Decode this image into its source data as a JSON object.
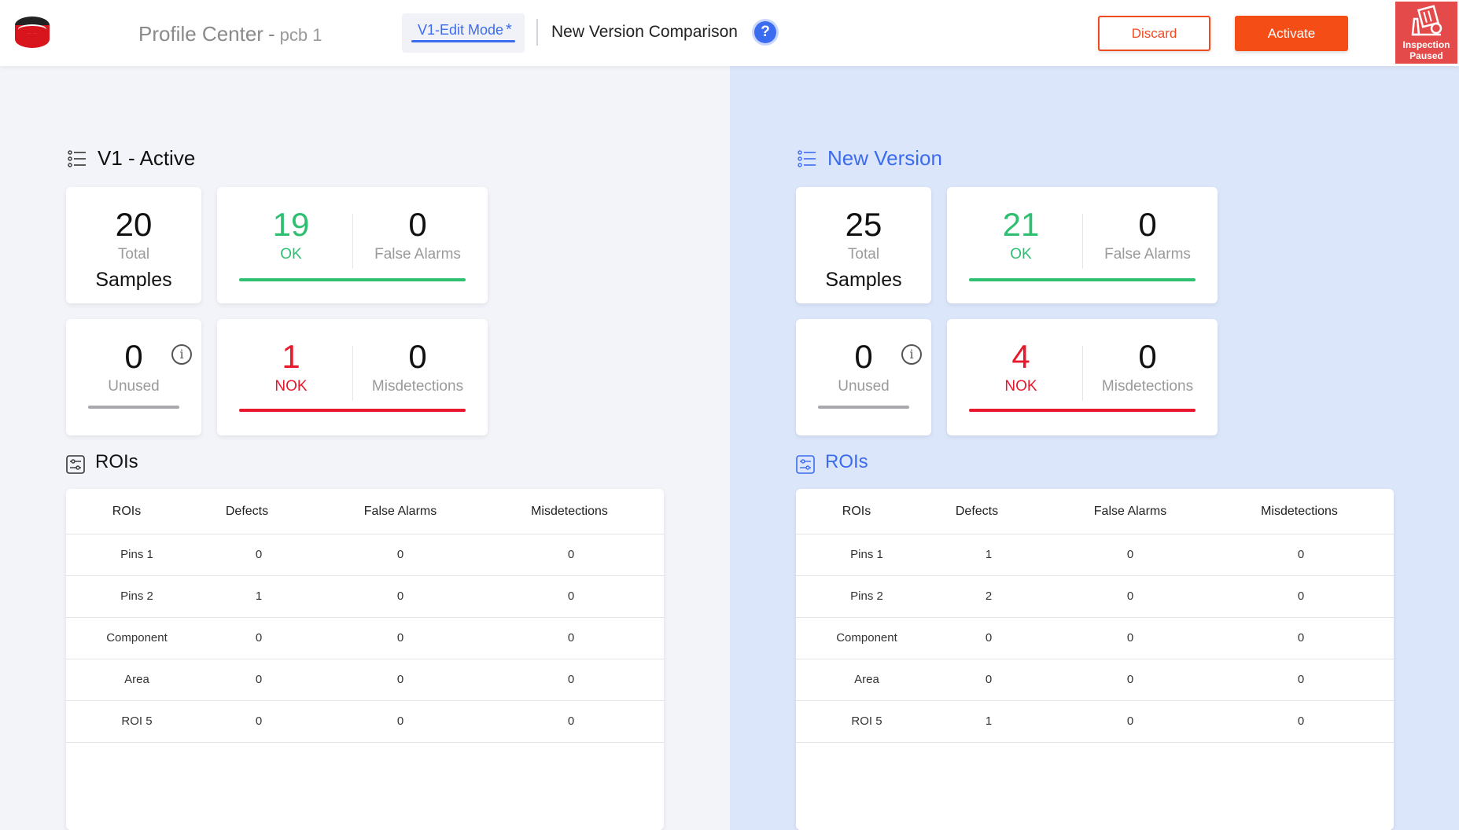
{
  "header": {
    "app_title": "Profile Center",
    "title_separator": "-",
    "profile_name": "pcb 1",
    "mode_label": "V1-Edit Mode",
    "mode_asterisk": "*",
    "comparison_title": "New Version Comparison",
    "help_symbol": "?",
    "discard_label": "Discard",
    "activate_label": "Activate",
    "inspection_status_line1": "Inspection",
    "inspection_status_line2": "Paused"
  },
  "colors": {
    "accent_blue": "#3b6cf0",
    "accent_orange": "#f54d16",
    "ok_green": "#2fbf71",
    "nok_red": "#e8192c",
    "right_panel_bg": "#dce6fa"
  },
  "left": {
    "title": "V1 - Active",
    "total": {
      "value": "20",
      "label": "Total",
      "sublabel": "Samples"
    },
    "ok": {
      "value": "19",
      "label": "OK"
    },
    "false_alarms": {
      "value": "0",
      "label": "False Alarms"
    },
    "unused": {
      "value": "0",
      "label": "Unused",
      "info": "i"
    },
    "nok": {
      "value": "1",
      "label": "NOK"
    },
    "misdetections": {
      "value": "0",
      "label": "Misdetections"
    },
    "rois_title": "ROIs",
    "table": {
      "headers": [
        "ROIs",
        "Defects",
        "False Alarms",
        "Misdetections"
      ],
      "rows": [
        [
          "Pins 1",
          "0",
          "0",
          "0"
        ],
        [
          "Pins 2",
          "1",
          "0",
          "0"
        ],
        [
          "Component",
          "0",
          "0",
          "0"
        ],
        [
          "Area",
          "0",
          "0",
          "0"
        ],
        [
          "ROI 5",
          "0",
          "0",
          "0"
        ]
      ]
    }
  },
  "right": {
    "title": "New Version",
    "total": {
      "value": "25",
      "label": "Total",
      "sublabel": "Samples"
    },
    "ok": {
      "value": "21",
      "label": "OK"
    },
    "false_alarms": {
      "value": "0",
      "label": "False Alarms"
    },
    "unused": {
      "value": "0",
      "label": "Unused",
      "info": "i"
    },
    "nok": {
      "value": "4",
      "label": "NOK"
    },
    "misdetections": {
      "value": "0",
      "label": "Misdetections"
    },
    "rois_title": "ROIs",
    "table": {
      "headers": [
        "ROIs",
        "Defects",
        "False Alarms",
        "Misdetections"
      ],
      "rows": [
        [
          "Pins 1",
          "1",
          "0",
          "0"
        ],
        [
          "Pins 2",
          "2",
          "0",
          "0"
        ],
        [
          "Component",
          "0",
          "0",
          "0"
        ],
        [
          "Area",
          "0",
          "0",
          "0"
        ],
        [
          "ROI 5",
          "1",
          "0",
          "0"
        ]
      ]
    }
  }
}
